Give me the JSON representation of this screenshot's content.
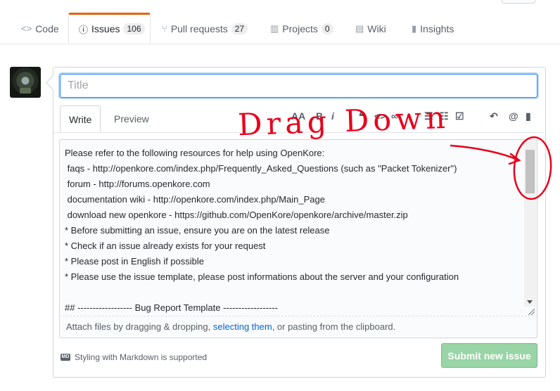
{
  "nav": {
    "tabs": [
      {
        "label": "Code",
        "icon": "code-icon"
      },
      {
        "label": "Issues",
        "count": "106",
        "icon": "issue-opened-icon"
      },
      {
        "label": "Pull requests",
        "count": "27",
        "icon": "git-pull-request-icon"
      },
      {
        "label": "Projects",
        "count": "0",
        "icon": "project-icon"
      },
      {
        "label": "Wiki",
        "icon": "book-icon"
      },
      {
        "label": "Insights",
        "icon": "graph-icon"
      }
    ],
    "selected": "Issues"
  },
  "form": {
    "title_placeholder": "Title",
    "editor_tabs": [
      "Write",
      "Preview"
    ],
    "toolbar_icons": [
      "text-size-icon",
      "bold-icon",
      "italic-icon",
      "quote-icon",
      "code-icon",
      "link-icon",
      "unordered-list-icon",
      "ordered-list-icon",
      "task-list-icon",
      "reply-icon",
      "mention-icon",
      "bookmark-icon"
    ],
    "toolbar_glyphs": {
      "text_size": "AA",
      "bold": "B",
      "italic": "i",
      "quote": "❝",
      "code": "<>",
      "link": "∞",
      "mention": "@"
    },
    "body_lines": [
      "Please refer to the following resources for help using OpenKore:",
      " faqs - http://openkore.com/index.php/Frequently_Asked_Questions (such as \"Packet Tokenizer\")",
      " forum - http://forums.openkore.com",
      " documentation wiki - http://openkore.com/index.php/Main_Page",
      " download new openkore - https://github.com/OpenKore/openkore/archive/master.zip",
      "* Before submitting an issue, ensure you are on the latest release",
      "* Check if an issue already exists for your request",
      "* Please post in English if possible",
      "* Please use the issue template, please post informations about the server and your configuration",
      "",
      "## ------------------ Bug Report Template ------------------"
    ],
    "attach": {
      "before": "Attach files by dragging & dropping, ",
      "link": "selecting them",
      "after": ", or pasting from the clipboard."
    },
    "markdown_note": "Styling with Markdown is supported",
    "markdown_badge": "MD",
    "submit_label": "Submit new issue"
  },
  "annotation": {
    "text": "Drag Down",
    "color": "#e8001c"
  }
}
